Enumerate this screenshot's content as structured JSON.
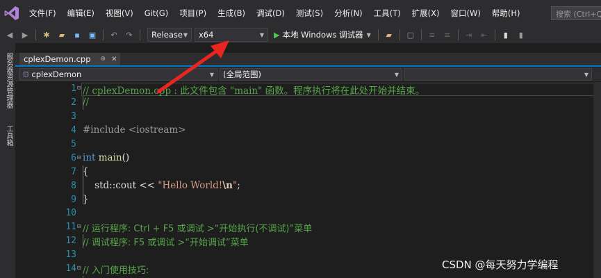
{
  "menu": {
    "items": [
      "文件(F)",
      "编辑(E)",
      "视图(V)",
      "Git(G)",
      "项目(P)",
      "生成(B)",
      "调试(D)",
      "测试(S)",
      "分析(N)",
      "工具(T)",
      "扩展(X)",
      "窗口(W)",
      "帮助(H)"
    ],
    "search_placeholder": "搜索 (Ctrl+Q)"
  },
  "toolbar": {
    "configuration": "Release",
    "platform": "x64",
    "run_label": "本地 Windows 调试器"
  },
  "side_panels": [
    "服务器资源管理器",
    "工具箱"
  ],
  "tab": {
    "filename": "cplexDemon.cpp"
  },
  "navbar": {
    "project": "cplexDemon",
    "scope": "(全局范围)"
  },
  "editor": {
    "line_numbers": [
      "1",
      "2",
      "3",
      "4",
      "5",
      "6",
      "7",
      "8",
      "9",
      "10",
      "11",
      "12",
      "13",
      "14"
    ],
    "lines": {
      "l1": "// cplexDemon.cpp : 此文件包含 \"main\" 函数。程序执行将在此处开始并结束。",
      "l2": "//",
      "l4": "#include <iostream>",
      "l6_kw": "int",
      "l6_fn": " main",
      "l6_rest": "()",
      "l7": "{",
      "l8_a": "    std::cout << ",
      "l8_str1": "\"Hello World!",
      "l8_esc": "\\n",
      "l8_str2": "\"",
      "l8_end": ";",
      "l9": "}",
      "l11": "// 运行程序: Ctrl + F5 或调试 >“开始执行(不调试)”菜单",
      "l12": "// 调试程序: F5 或调试 >“开始调试”菜单",
      "l14": "// 入门使用技巧:"
    }
  },
  "watermark": "CSDN @每天努力学编程",
  "colors": {
    "comment": "#57a64a",
    "keyword": "#569cd6",
    "line_number": "#2b91af",
    "annotation_arrow": "#e8251f"
  }
}
